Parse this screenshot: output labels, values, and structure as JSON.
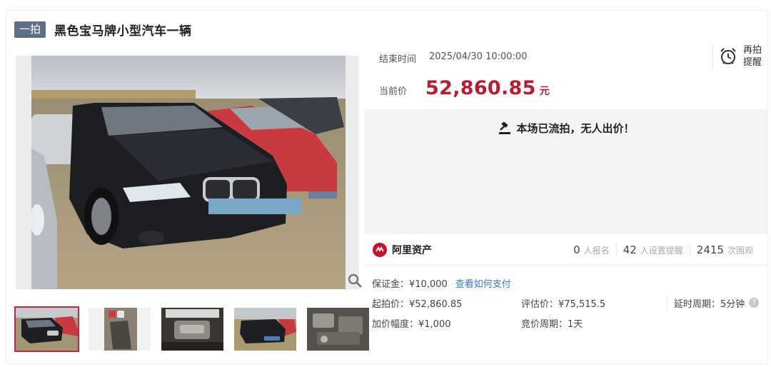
{
  "header": {
    "badge": "一拍",
    "title": "黑色宝马牌小型汽车一辆"
  },
  "gallery": {
    "main_image_alt": "black BMW sedan parked on dry grass",
    "thumbnails": [
      {
        "name": "front-view",
        "active": true
      },
      {
        "name": "tire-detail",
        "active": false
      },
      {
        "name": "engine-bay",
        "active": false
      },
      {
        "name": "front-view-2",
        "active": false
      },
      {
        "name": "engine-detail",
        "active": false
      }
    ]
  },
  "auction": {
    "end_label": "结束时间",
    "end_time": "2025/04/30 10:00:00",
    "price_label": "当前价",
    "price": "52,860.85",
    "price_unit": "元",
    "remind_line1": "再拍",
    "remind_line2": "提醒",
    "status": "本场已流拍，无人出价！"
  },
  "platform": {
    "name": "阿里资产",
    "signups": "0",
    "signups_label": "人报名",
    "reminders": "42",
    "reminders_label": "人设置提醒",
    "views": "2415",
    "views_label": "次围观"
  },
  "details": {
    "deposit": "保证金：¥10,000",
    "deposit_link": "查看如何支付",
    "start_price": "起拍价：¥52,860.85",
    "estimate": "评估价：¥75,515.5",
    "extension": "延时周期：5分钟",
    "increment": "加价幅度：¥1,000",
    "cycle": "竞价周期：1天"
  },
  "colors": {
    "accent": "#b81c32",
    "badge_bg": "#5c6f86",
    "link": "#2f7bd9"
  }
}
